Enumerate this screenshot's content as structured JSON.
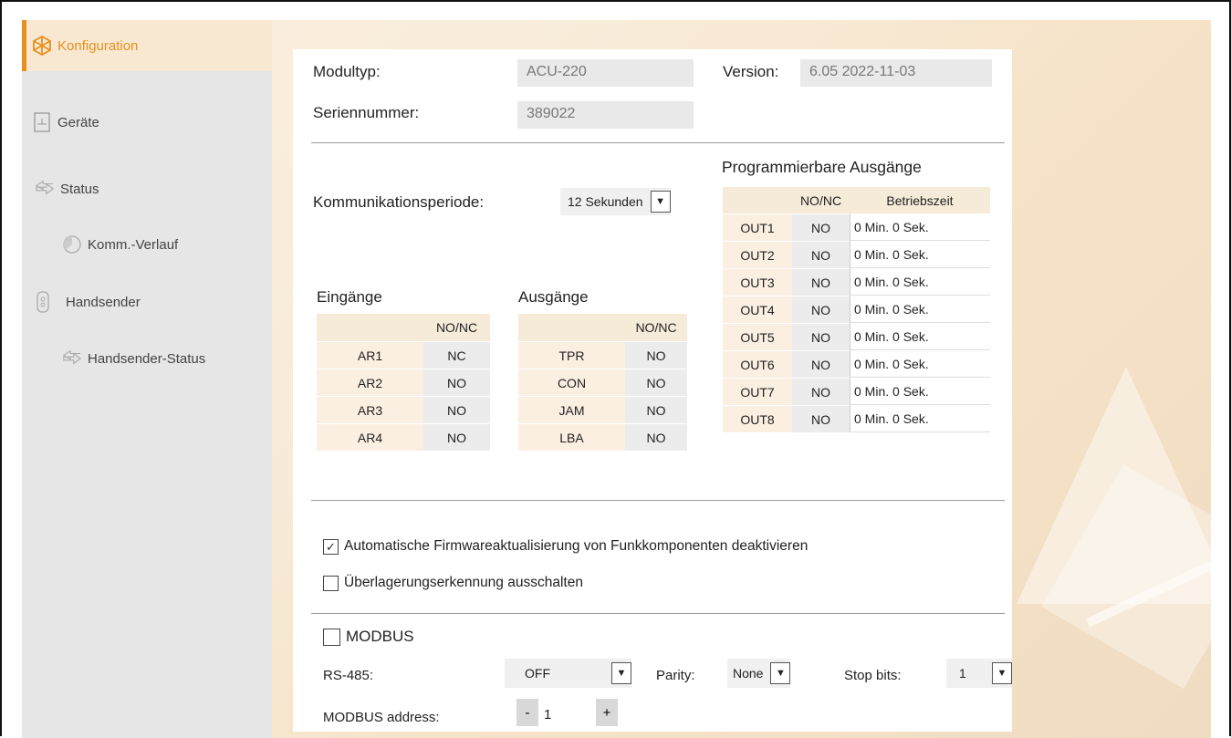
{
  "sidebar": {
    "items": [
      {
        "label": "Konfiguration",
        "icon": "config-icon"
      },
      {
        "label": "Geräte",
        "icon": "device-icon"
      },
      {
        "label": "Status",
        "icon": "status-arrows-icon"
      },
      {
        "label": "Komm.-Verlauf",
        "icon": "history-icon"
      },
      {
        "label": "Handsender",
        "icon": "keyfob-icon"
      },
      {
        "label": "Handsender-Status",
        "icon": "status-arrows-icon"
      }
    ],
    "accent_color": "#e8901e"
  },
  "module": {
    "type_label": "Modultyp:",
    "type_value": "ACU-220",
    "serial_label": "Seriennummer:",
    "serial_value": "389022",
    "version_label": "Version:",
    "version_value": "6.05 2022-11-03"
  },
  "comm": {
    "label": "Kommunikationsperiode:",
    "value": "12 Sekunden"
  },
  "inputs": {
    "title": "Eingänge",
    "header": "NO/NC",
    "rows": [
      {
        "name": "AR1",
        "value": "NC"
      },
      {
        "name": "AR2",
        "value": "NO"
      },
      {
        "name": "AR3",
        "value": "NO"
      },
      {
        "name": "AR4",
        "value": "NO"
      }
    ]
  },
  "outputs": {
    "title": "Ausgänge",
    "header": "NO/NC",
    "rows": [
      {
        "name": "TPR",
        "value": "NO"
      },
      {
        "name": "CON",
        "value": "NO"
      },
      {
        "name": "JAM",
        "value": "NO"
      },
      {
        "name": "LBA",
        "value": "NO"
      }
    ]
  },
  "prog_outputs": {
    "title": "Programmierbare Ausgänge",
    "header_nonc": "NO/NC",
    "header_time": "Betriebszeit",
    "rows": [
      {
        "name": "OUT1",
        "value": "NO",
        "time": "0 Min. 0 Sek."
      },
      {
        "name": "OUT2",
        "value": "NO",
        "time": "0 Min. 0 Sek."
      },
      {
        "name": "OUT3",
        "value": "NO",
        "time": "0 Min. 0 Sek."
      },
      {
        "name": "OUT4",
        "value": "NO",
        "time": "0 Min. 0 Sek."
      },
      {
        "name": "OUT5",
        "value": "NO",
        "time": "0 Min. 0 Sek."
      },
      {
        "name": "OUT6",
        "value": "NO",
        "time": "0 Min. 0 Sek."
      },
      {
        "name": "OUT7",
        "value": "NO",
        "time": "0 Min. 0 Sek."
      },
      {
        "name": "OUT8",
        "value": "NO",
        "time": "0 Min. 0 Sek."
      }
    ]
  },
  "checkboxes": {
    "firmware": {
      "label": "Automatische Firmwareaktualisierung von Funkkomponenten deaktivieren",
      "checked": true
    },
    "overlay": {
      "label": "Überlagerungserkennung ausschalten",
      "checked": false
    }
  },
  "modbus": {
    "label": "MODBUS",
    "checked": false,
    "rs485_label": "RS-485:",
    "rs485_value": "OFF",
    "parity_label": "Parity:",
    "parity_value": "None",
    "stopbits_label": "Stop bits:",
    "stopbits_value": "1",
    "address_label": "MODBUS address:",
    "address_value": "1",
    "minus": "-",
    "plus": "+"
  }
}
